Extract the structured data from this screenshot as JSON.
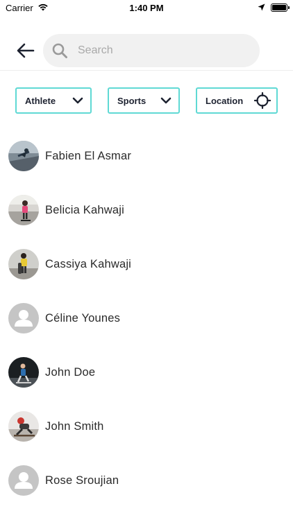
{
  "status_bar": {
    "carrier": "Carrier",
    "time": "1:40 PM"
  },
  "search": {
    "placeholder": "Search",
    "value": ""
  },
  "filters": {
    "athlete_label": "Athlete",
    "sports_label": "Sports",
    "location_label": "Location"
  },
  "colors": {
    "accent": "#5fd9d4",
    "text_dark": "#1d2230",
    "search_bg": "#f1f1f1",
    "avatar_placeholder": "#c5c5c5"
  },
  "people": [
    {
      "name": "Fabien El Asmar",
      "avatar": "photo-snowboard"
    },
    {
      "name": "Belicia Kahwaji",
      "avatar": "photo-skater-pink"
    },
    {
      "name": "Cassiya Kahwaji",
      "avatar": "photo-skater-yellow"
    },
    {
      "name": "Céline Younes",
      "avatar": "placeholder-user-icon"
    },
    {
      "name": "John Doe",
      "avatar": "photo-skater-dark"
    },
    {
      "name": "John Smith",
      "avatar": "photo-skater-red-helmet"
    },
    {
      "name": "Rose Sroujian",
      "avatar": "placeholder-user-icon"
    }
  ]
}
